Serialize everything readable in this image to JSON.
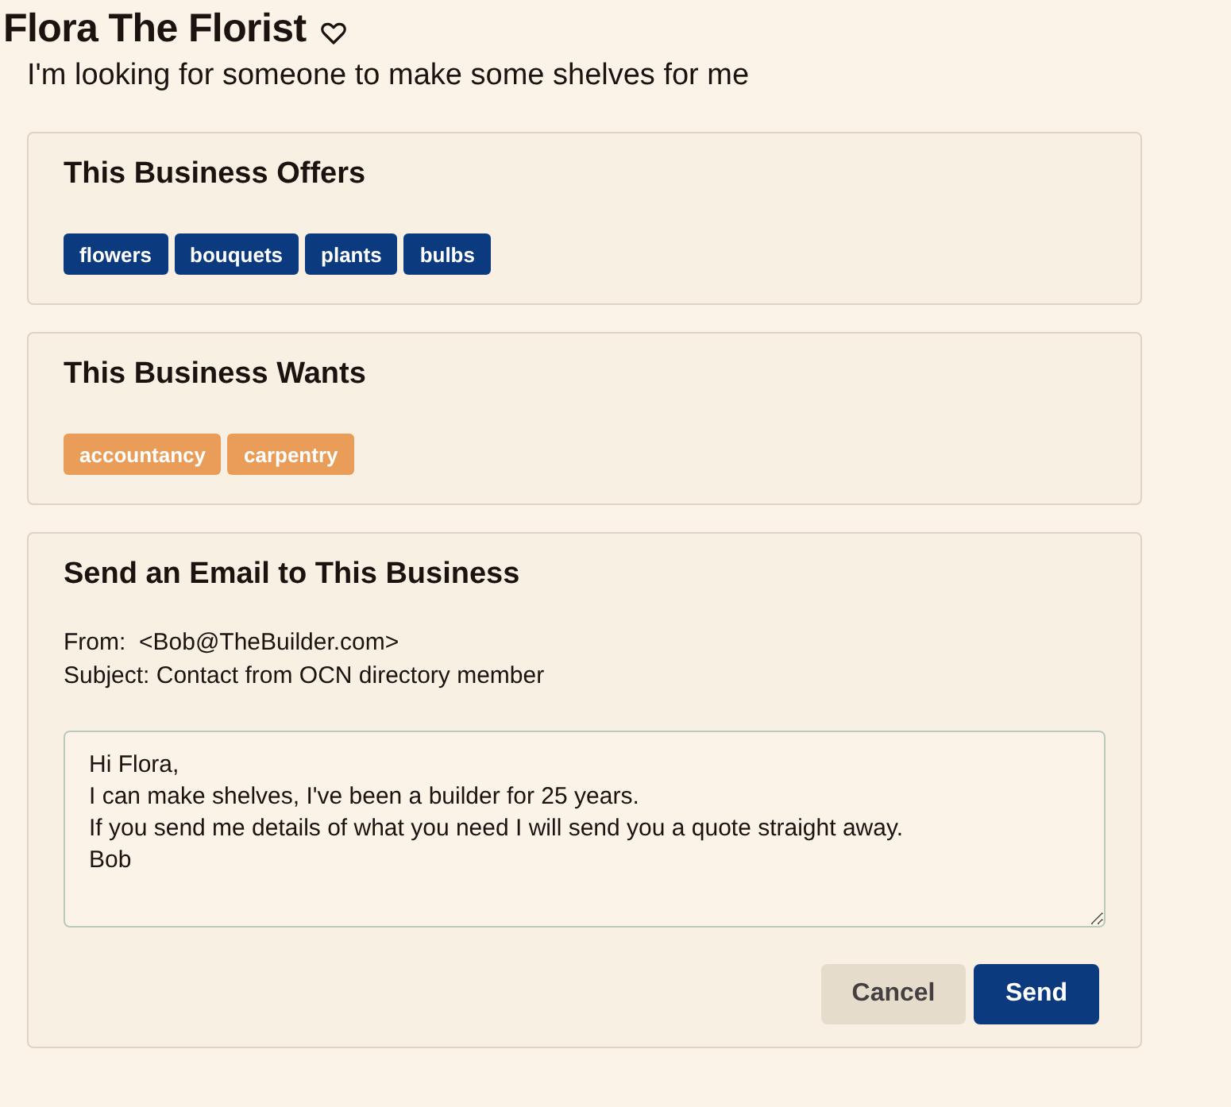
{
  "business": {
    "name": "Flora The Florist",
    "favorite": false,
    "request": "I'm looking for someone to make some shelves for me"
  },
  "sections": [
    {
      "kind": "offers",
      "heading": "This Business Offers",
      "tags": [
        "flowers",
        "bouquets",
        "plants",
        "bulbs"
      ]
    },
    {
      "kind": "wants",
      "heading": "This Business Wants",
      "tags": [
        "accountancy",
        "carpentry"
      ]
    }
  ],
  "email": {
    "heading": "Send an Email to This Business",
    "lines": [
      "From:  <Bob@TheBuilder.com>",
      "Subject: Contact from OCN directory member"
    ],
    "message": "Hi Flora,\nI can make shelves, I've been a builder for 25 years.\nIf you send me details of what you need I will send you a quote straight away.\nBob",
    "buttons": [
      {
        "label": "Cancel",
        "kind": "secondary"
      },
      {
        "label": "Send",
        "kind": "primary"
      }
    ]
  }
}
